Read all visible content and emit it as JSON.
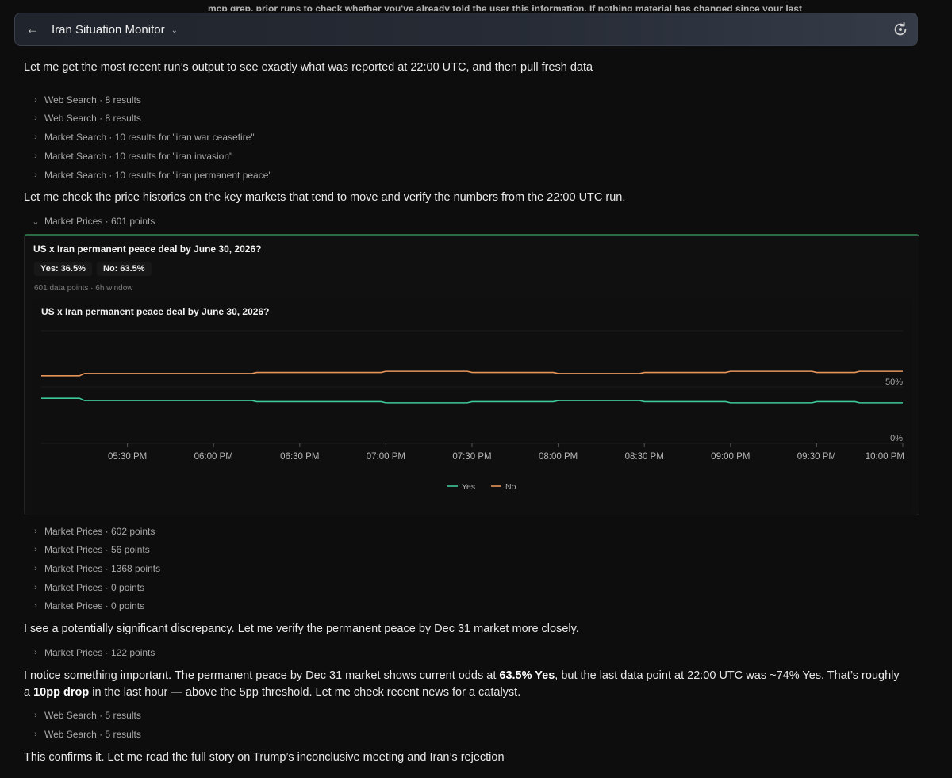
{
  "topbar": {
    "title": "Iran Situation Monitor",
    "ghost_text": "mcp grep, prior runs to check whether you've already told the user this information. If nothing material has changed since your last"
  },
  "messages": {
    "m1": "Let me get the most recent run’s output to see exactly what was reported at 22:00 UTC, and then pull fresh data",
    "m2": "Let me check the price histories on the key markets that tend to move and verify the numbers from the 22:00 UTC run.",
    "m3": "I see a potentially significant discrepancy. Let me verify the permanent peace by Dec 31 market more closely.",
    "m4_a": "I notice something important. The permanent peace by Dec 31 market shows current odds at ",
    "m4_b": "63.5% Yes",
    "m4_c": ", but the last data point at 22:00 UTC was ~74% Yes. That’s roughly a ",
    "m4_d": "10pp drop",
    "m4_e": " in the last hour — above the 5pp threshold. Let me check recent news for a catalyst.",
    "m5": "This confirms it. Let me read the full story on Trump’s inconclusive meeting and Iran’s rejection"
  },
  "tools_a": [
    "Web Search · 8 results",
    "Web Search · 8 results",
    "Market Search · 10 results for \"iran war ceasefire\"",
    "Market Search · 10 results for \"iran invasion\"",
    "Market Search · 10 results for \"iran permanent peace\""
  ],
  "tool_expanded": "Market Prices · 601 points",
  "tools_b": [
    "Market Prices · 602 points",
    "Market Prices · 56 points",
    "Market Prices · 1368 points",
    "Market Prices · 0 points",
    "Market Prices · 0 points"
  ],
  "tool_c": "Market Prices · 122 points",
  "tools_d": [
    "Web Search · 5 results",
    "Web Search · 5 results"
  ],
  "card": {
    "title": "US x Iran permanent peace deal by June 30, 2026?",
    "yes_pill": "Yes: 36.5%",
    "no_pill": "No: 63.5%",
    "meta": "601 data points · 6h window",
    "accent": "#2c6a43"
  },
  "chart_data": {
    "type": "line",
    "title": "US x Iran permanent peace deal by June 30, 2026?",
    "x": [
      "05:05 PM",
      "05:15 PM",
      "05:30 PM",
      "05:45 PM",
      "06:00 PM",
      "06:15 PM",
      "06:30 PM",
      "06:45 PM",
      "07:00 PM",
      "07:15 PM",
      "07:30 PM",
      "07:45 PM",
      "08:00 PM",
      "08:15 PM",
      "08:30 PM",
      "08:45 PM",
      "09:00 PM",
      "09:15 PM",
      "09:30 PM",
      "09:45 PM",
      "10:00 PM"
    ],
    "x_ticks": [
      "05:30 PM",
      "06:00 PM",
      "06:30 PM",
      "07:00 PM",
      "07:30 PM",
      "08:00 PM",
      "08:30 PM",
      "09:00 PM",
      "09:30 PM",
      "10:00 PM"
    ],
    "y_ticks": [
      "50%",
      "0%"
    ],
    "ylim": [
      0,
      100
    ],
    "series": [
      {
        "name": "Yes",
        "color": "#3ec79a",
        "values": [
          40,
          38,
          38,
          38,
          38,
          37,
          37,
          37,
          36,
          36,
          37,
          37,
          38,
          38,
          37,
          37,
          36,
          36,
          37,
          36,
          36
        ]
      },
      {
        "name": "No",
        "color": "#e8955a",
        "values": [
          60,
          62,
          62,
          62,
          62,
          63,
          63,
          63,
          64,
          64,
          63,
          63,
          62,
          62,
          63,
          63,
          64,
          64,
          63,
          64,
          64
        ]
      }
    ],
    "legend": "bottom-center",
    "grid": true
  }
}
